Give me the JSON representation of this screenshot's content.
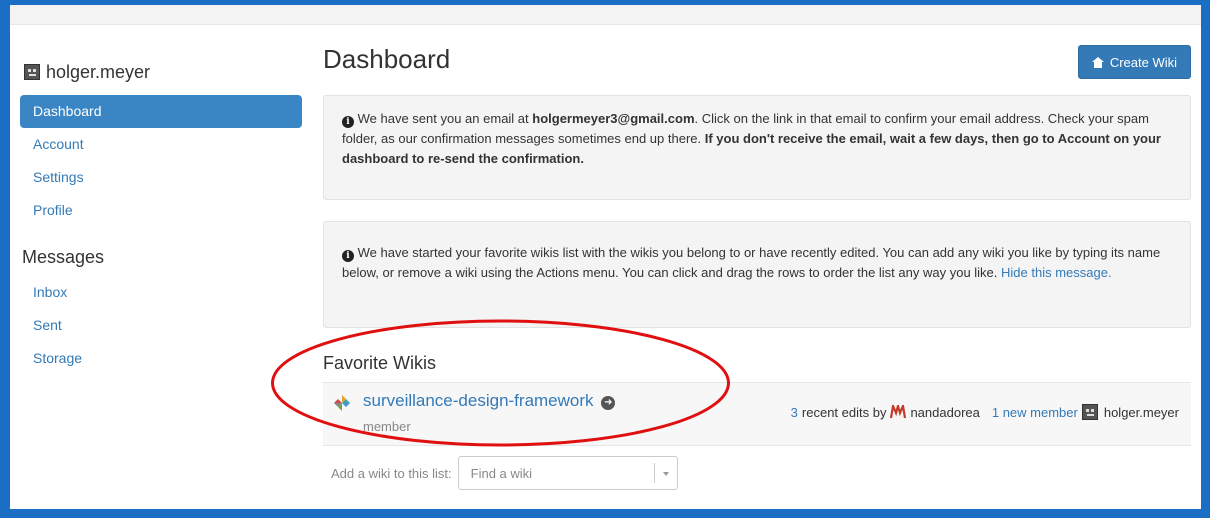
{
  "sidebar": {
    "username": "holger.meyer",
    "nav": [
      {
        "label": "Dashboard",
        "active": true
      },
      {
        "label": "Account",
        "active": false
      },
      {
        "label": "Settings",
        "active": false
      },
      {
        "label": "Profile",
        "active": false
      }
    ],
    "messages_title": "Messages",
    "messages_nav": [
      {
        "label": "Inbox"
      },
      {
        "label": "Sent"
      },
      {
        "label": "Storage"
      }
    ]
  },
  "header": {
    "title": "Dashboard",
    "create_button": "Create Wiki"
  },
  "alert_email": {
    "text_1": "We have sent you an email at ",
    "email": "holgermeyer3@gmail.com",
    "text_2": ". Click on the link in that email to confirm your email address. Check your spam folder, as our confirmation messages sometimes end up there. ",
    "bold_text": "If you don't receive the email, wait a few days, then go to Account on your dashboard to re-send the confirmation."
  },
  "alert_favorites": {
    "text": "We have started your favorite wikis list with the wikis you belong to or have recently edited. You can add any wiki you like by typing its name below, or remove a wiki using the Actions menu. You can click and drag the rows to order the list any way you like. ",
    "hide_link": "Hide this message."
  },
  "favorites": {
    "title": "Favorite Wikis",
    "wikis": [
      {
        "name": "surveillance-design-framework",
        "role": "member",
        "recent_edits_count": "3",
        "recent_edits_text": "recent edits by",
        "editor": "nandadorea",
        "new_member_link": "1 new member",
        "new_member_name": "holger.meyer"
      }
    ],
    "add_label": "Add a wiki to this list:",
    "find_placeholder": "Find a wiki"
  },
  "colors": {
    "accent": "#337ab7",
    "annotation": "#e01010",
    "frame": "#1a6fc4"
  }
}
